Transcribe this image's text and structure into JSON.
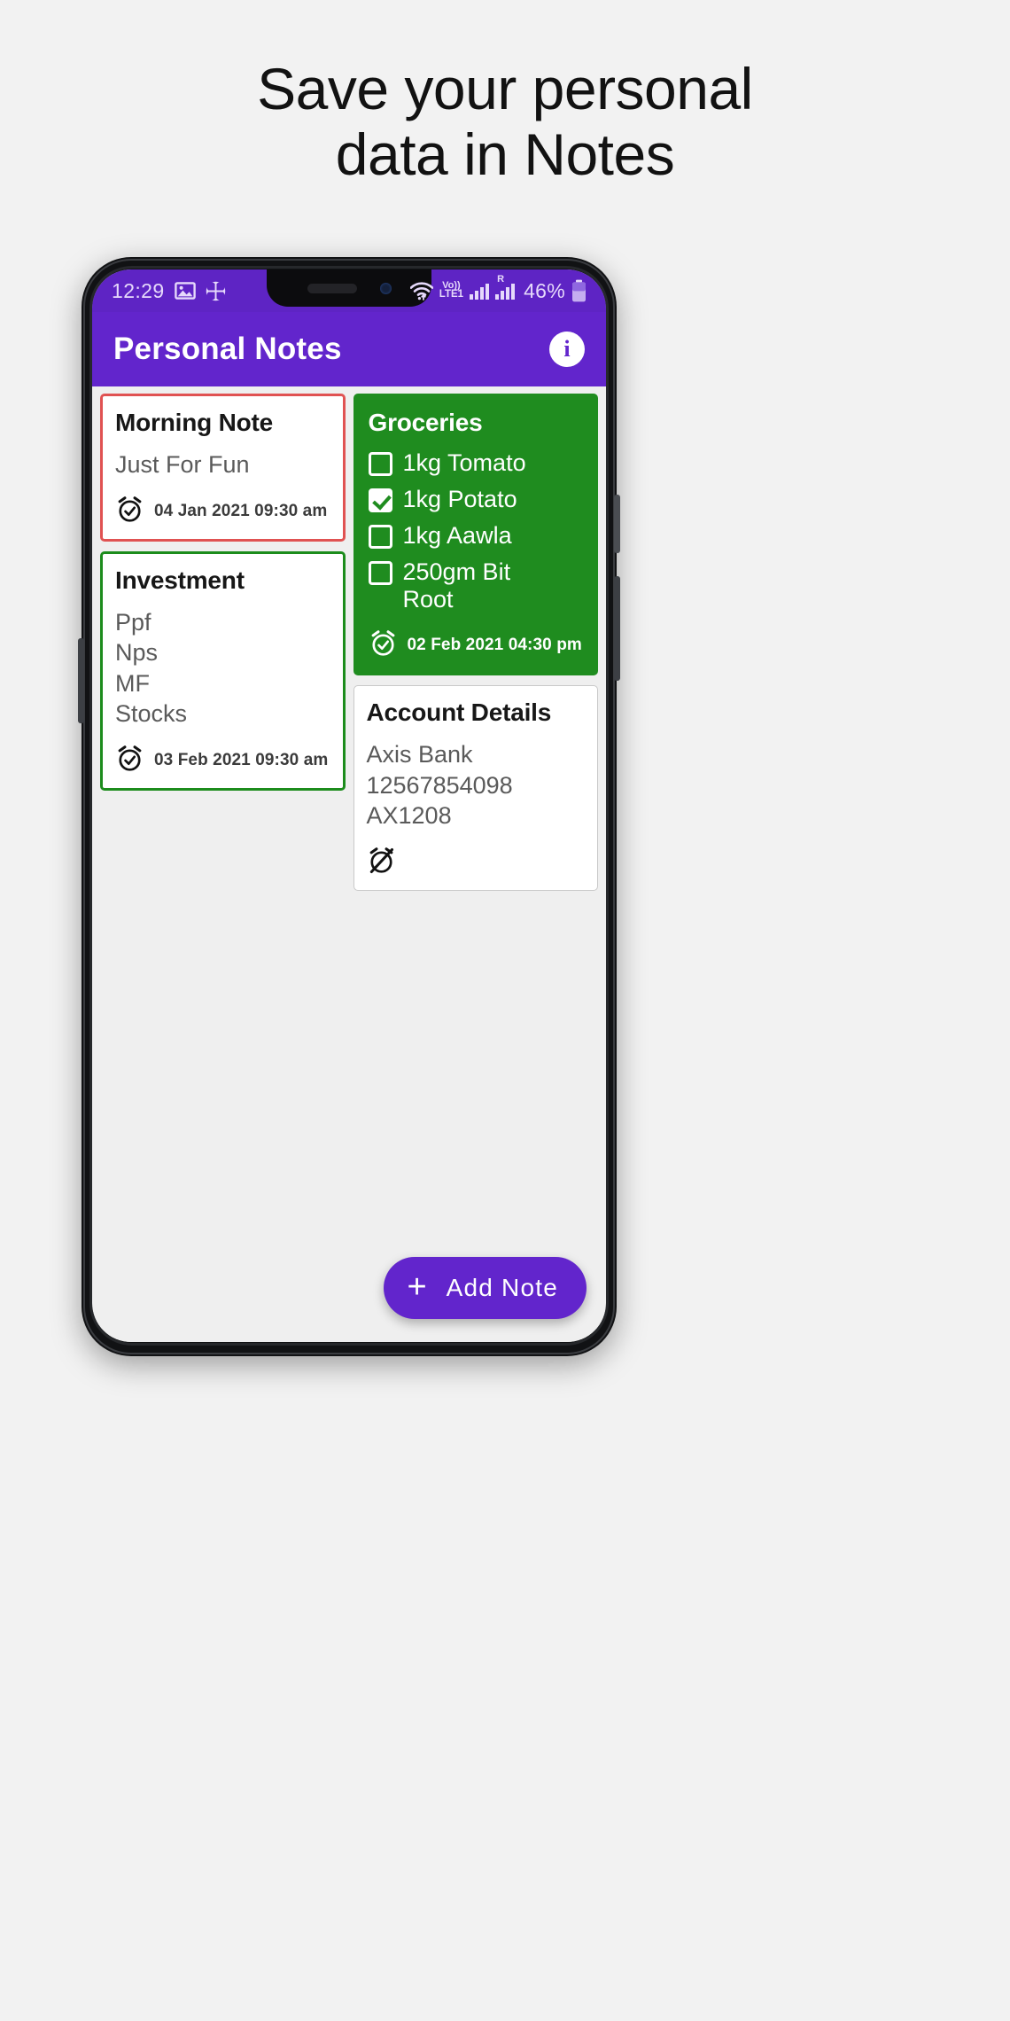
{
  "headline": {
    "line1": "Save your personal",
    "line2": "data in Notes"
  },
  "status_bar": {
    "time": "12:29",
    "icons": [
      "image-icon",
      "flower-icon",
      "wifi-icon",
      "volte-icon",
      "signal-icon",
      "roaming-signal-icon",
      "battery-icon"
    ],
    "volte_top": "Vo))",
    "volte_bottom": "LTE1",
    "roaming_label": "R",
    "battery_percent": "46%"
  },
  "app_bar": {
    "title": "Personal Notes",
    "info_label": "i"
  },
  "colors": {
    "purple": "#6225cc",
    "status_purple": "#5e24c4",
    "green": "#1f8c1f",
    "green_border": "#1c8c1c",
    "red_border": "#e05252",
    "page_bg": "#efefef"
  },
  "notes": [
    {
      "id": "morning-note",
      "title": "Morning Note",
      "style": "red",
      "body_lines": [
        "Just For Fun"
      ],
      "date": "04 Jan 2021 09:30 am",
      "alarm": "on"
    },
    {
      "id": "groceries",
      "title": "Groceries",
      "style": "filled-green",
      "checklist": [
        {
          "label": "1kg Tomato",
          "checked": false
        },
        {
          "label": "1kg Potato",
          "checked": true
        },
        {
          "label": "1kg Aawla",
          "checked": false
        },
        {
          "label": "250gm Bit Root",
          "checked": false
        }
      ],
      "date": "02 Feb 2021 04:30 pm",
      "alarm": "on"
    },
    {
      "id": "investment",
      "title": "Investment",
      "style": "green",
      "body_lines": [
        "Ppf",
        "Nps",
        "MF",
        "Stocks"
      ],
      "date": "03 Feb 2021 09:30 am",
      "alarm": "on"
    },
    {
      "id": "account-details",
      "title": "Account Details",
      "style": "plain",
      "body_lines": [
        "Axis Bank",
        "12567854098",
        "AX1208"
      ],
      "date": "",
      "alarm": "off"
    }
  ],
  "fab": {
    "plus": "+",
    "label": "Add Note"
  }
}
